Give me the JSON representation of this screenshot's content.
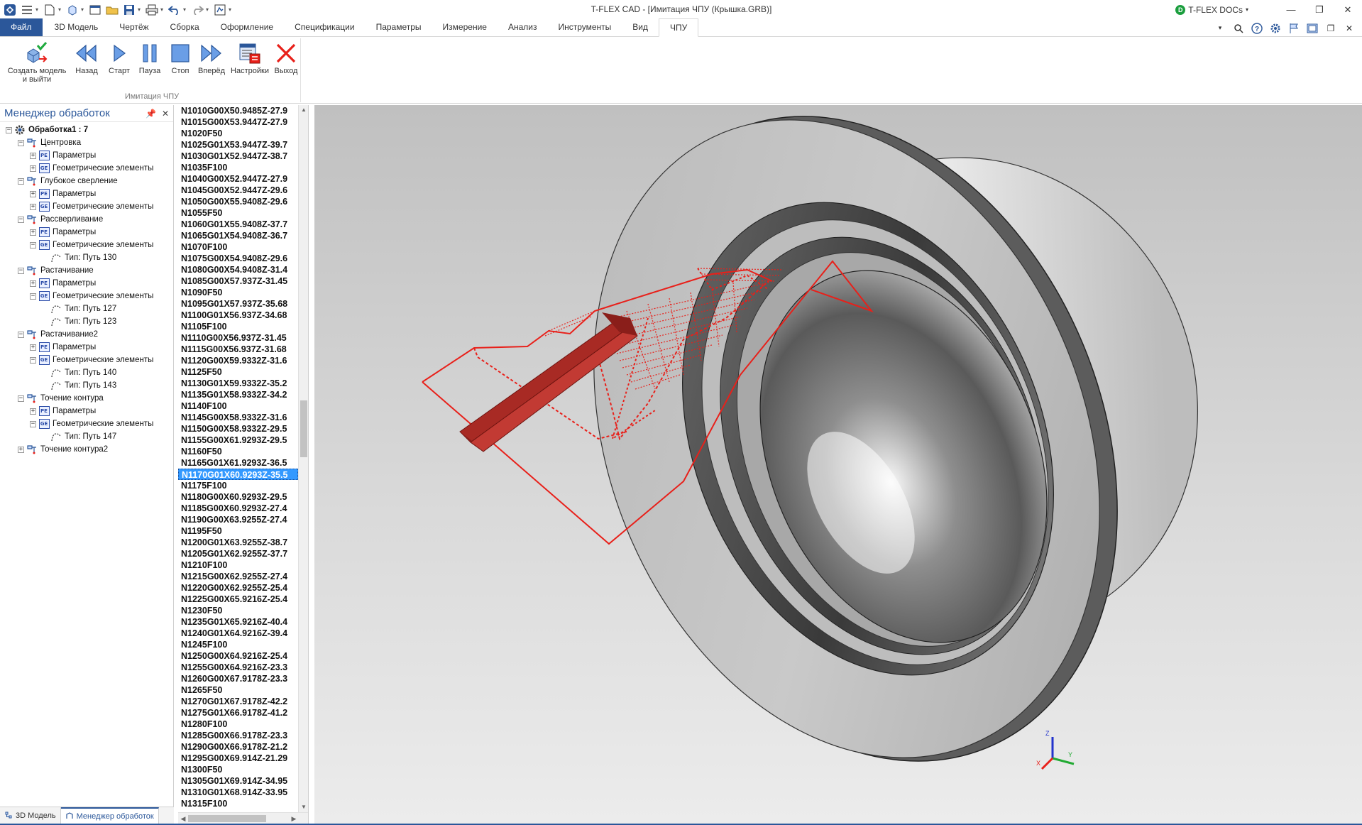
{
  "window": {
    "title": "T-FLEX CAD - [Имитация ЧПУ (Крышка.GRB)]",
    "docs_label": "T-FLEX DOCs"
  },
  "tabs": [
    {
      "label": "Файл"
    },
    {
      "label": "3D Модель"
    },
    {
      "label": "Чертёж"
    },
    {
      "label": "Сборка"
    },
    {
      "label": "Оформление"
    },
    {
      "label": "Спецификации"
    },
    {
      "label": "Параметры"
    },
    {
      "label": "Измерение"
    },
    {
      "label": "Анализ"
    },
    {
      "label": "Инструменты"
    },
    {
      "label": "Вид"
    },
    {
      "label": "ЧПУ"
    }
  ],
  "active_tab": "ЧПУ",
  "ribbon": {
    "group_label": "Имитация ЧПУ",
    "buttons": [
      {
        "label_line1": "Создать модель",
        "label_line2": "и выйти",
        "icon": "create-model-exit-icon"
      },
      {
        "label_line1": "Назад",
        "label_line2": "",
        "icon": "rewind-icon"
      },
      {
        "label_line1": "Старт",
        "label_line2": "",
        "icon": "play-icon"
      },
      {
        "label_line1": "Пауза",
        "label_line2": "",
        "icon": "pause-icon"
      },
      {
        "label_line1": "Стоп",
        "label_line2": "",
        "icon": "stop-icon"
      },
      {
        "label_line1": "Вперёд",
        "label_line2": "",
        "icon": "fast-forward-icon"
      },
      {
        "label_line1": "Настройки",
        "label_line2": "",
        "icon": "settings-icon"
      },
      {
        "label_line1": "Выход",
        "label_line2": "",
        "icon": "exit-icon"
      }
    ]
  },
  "manager": {
    "title": "Менеджер обработок",
    "tree": [
      {
        "level": 0,
        "exp": "-",
        "icon": "gear",
        "label": "Обработка1 : 7",
        "bold": true
      },
      {
        "level": 1,
        "exp": "-",
        "icon": "op",
        "label": "Центровка"
      },
      {
        "level": 2,
        "exp": "+",
        "icon": "pe",
        "label": "Параметры"
      },
      {
        "level": 2,
        "exp": "+",
        "icon": "ge",
        "label": "Геометрические элементы"
      },
      {
        "level": 1,
        "exp": "-",
        "icon": "op",
        "label": "Глубокое сверление"
      },
      {
        "level": 2,
        "exp": "+",
        "icon": "pe",
        "label": "Параметры"
      },
      {
        "level": 2,
        "exp": "+",
        "icon": "ge",
        "label": "Геометрические элементы"
      },
      {
        "level": 1,
        "exp": "-",
        "icon": "op",
        "label": "Рассверливание"
      },
      {
        "level": 2,
        "exp": "+",
        "icon": "pe",
        "label": "Параметры"
      },
      {
        "level": 2,
        "exp": "-",
        "icon": "ge",
        "label": "Геометрические элементы"
      },
      {
        "level": 3,
        "exp": "",
        "icon": "path",
        "label": "Тип: Путь 130"
      },
      {
        "level": 1,
        "exp": "-",
        "icon": "op",
        "label": "Растачивание"
      },
      {
        "level": 2,
        "exp": "+",
        "icon": "pe",
        "label": "Параметры"
      },
      {
        "level": 2,
        "exp": "-",
        "icon": "ge",
        "label": "Геометрические элементы"
      },
      {
        "level": 3,
        "exp": "",
        "icon": "path",
        "label": "Тип: Путь 127"
      },
      {
        "level": 3,
        "exp": "",
        "icon": "path",
        "label": "Тип: Путь 123"
      },
      {
        "level": 1,
        "exp": "-",
        "icon": "op",
        "label": "Растачивание2"
      },
      {
        "level": 2,
        "exp": "+",
        "icon": "pe",
        "label": "Параметры"
      },
      {
        "level": 2,
        "exp": "-",
        "icon": "ge",
        "label": "Геометрические элементы"
      },
      {
        "level": 3,
        "exp": "",
        "icon": "path",
        "label": "Тип: Путь 140"
      },
      {
        "level": 3,
        "exp": "",
        "icon": "path",
        "label": "Тип: Путь 143"
      },
      {
        "level": 1,
        "exp": "-",
        "icon": "op",
        "label": "Точение контура"
      },
      {
        "level": 2,
        "exp": "+",
        "icon": "pe",
        "label": "Параметры"
      },
      {
        "level": 2,
        "exp": "-",
        "icon": "ge",
        "label": "Геометрические элементы"
      },
      {
        "level": 3,
        "exp": "",
        "icon": "path",
        "label": "Тип: Путь 147"
      },
      {
        "level": 1,
        "exp": "+",
        "icon": "op",
        "label": "Точение контура2"
      }
    ],
    "bottom_tabs": [
      {
        "label": "3D Модель",
        "active": false
      },
      {
        "label": "Менеджер обработок",
        "active": true
      }
    ]
  },
  "gcode": {
    "selected_index": 32,
    "lines": [
      "N1010G00X50.9485Z-27.9",
      "N1015G00X53.9447Z-27.9",
      "N1020F50",
      "N1025G01X53.9447Z-39.7",
      "N1030G01X52.9447Z-38.7",
      "N1035F100",
      "N1040G00X52.9447Z-27.9",
      "N1045G00X52.9447Z-29.6",
      "N1050G00X55.9408Z-29.6",
      "N1055F50",
      "N1060G01X55.9408Z-37.7",
      "N1065G01X54.9408Z-36.7",
      "N1070F100",
      "N1075G00X54.9408Z-29.6",
      "N1080G00X54.9408Z-31.4",
      "N1085G00X57.937Z-31.45",
      "N1090F50",
      "N1095G01X57.937Z-35.68",
      "N1100G01X56.937Z-34.68",
      "N1105F100",
      "N1110G00X56.937Z-31.45",
      "N1115G00X56.937Z-31.68",
      "N1120G00X59.9332Z-31.6",
      "N1125F50",
      "N1130G01X59.9332Z-35.2",
      "N1135G01X58.9332Z-34.2",
      "N1140F100",
      "N1145G00X58.9332Z-31.6",
      "N1150G00X58.9332Z-29.5",
      "N1155G00X61.9293Z-29.5",
      "N1160F50",
      "N1165G01X61.9293Z-36.5",
      "N1170G01X60.9293Z-35.5",
      "N1175F100",
      "N1180G00X60.9293Z-29.5",
      "N1185G00X60.9293Z-27.4",
      "N1190G00X63.9255Z-27.4",
      "N1195F50",
      "N1200G01X63.9255Z-38.7",
      "N1205G01X62.9255Z-37.7",
      "N1210F100",
      "N1215G00X62.9255Z-27.4",
      "N1220G00X62.9255Z-25.4",
      "N1225G00X65.9216Z-25.4",
      "N1230F50",
      "N1235G01X65.9216Z-40.4",
      "N1240G01X64.9216Z-39.4",
      "N1245F100",
      "N1250G00X64.9216Z-25.4",
      "N1255G00X64.9216Z-23.3",
      "N1260G00X67.9178Z-23.3",
      "N1265F50",
      "N1270G01X67.9178Z-42.2",
      "N1275G01X66.9178Z-41.2",
      "N1280F100",
      "N1285G00X66.9178Z-23.3",
      "N1290G00X66.9178Z-21.2",
      "N1295G00X69.914Z-21.29",
      "N1300F50",
      "N1305G01X69.914Z-34.95",
      "N1310G01X68.914Z-33.95",
      "N1315F100"
    ]
  },
  "axes": {
    "x": "X",
    "y": "Y",
    "z": "Z"
  },
  "colors": {
    "accent": "#2b579a",
    "file_tab": "#2b579a",
    "selection": "#3399ff",
    "toolpath": "#e8201a",
    "tool": "#b5302a"
  }
}
